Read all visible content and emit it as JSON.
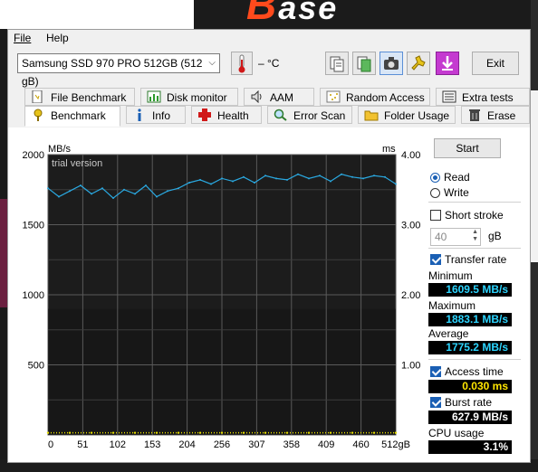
{
  "background": {
    "logo_letter": "B",
    "logo_rest": "ase"
  },
  "menu": {
    "file": "File",
    "help": "Help"
  },
  "toolbar": {
    "drive": "Samsung SSD 970 PRO 512GB (512 gB)",
    "temperature": "– °C",
    "exit": "Exit",
    "icons": [
      "copy-text-icon",
      "copy-info-icon",
      "screenshot-camera-icon",
      "options-icon",
      "save-download-icon"
    ]
  },
  "tabs_row1": [
    "File Benchmark",
    "Disk monitor",
    "AAM",
    "Random Access",
    "Extra tests"
  ],
  "tabs_row2": [
    "Benchmark",
    "Info",
    "Health",
    "Error Scan",
    "Folder Usage",
    "Erase"
  ],
  "selected_tab": "Benchmark",
  "side": {
    "start": "Start",
    "read": "Read",
    "write": "Write",
    "mode": "Read",
    "short_stroke": "Short stroke",
    "short_stroke_checked": false,
    "stroke_value": "40",
    "stroke_unit": "gB",
    "transfer_rate": "Transfer rate",
    "transfer_rate_checked": true,
    "minimum_label": "Minimum",
    "minimum": "1609.5 MB/s",
    "maximum_label": "Maximum",
    "maximum": "1883.1 MB/s",
    "average_label": "Average",
    "average": "1775.2 MB/s",
    "access_time": "Access time",
    "access_time_checked": true,
    "access_time_value": "0.030 ms",
    "burst_rate": "Burst rate",
    "burst_rate_checked": true,
    "burst_rate_value": "627.9 MB/s",
    "cpu_usage_label": "CPU usage",
    "cpu_usage": "3.1%"
  },
  "chart_data": {
    "type": "line",
    "watermark": "trial version",
    "ylabel_left": "MB/s",
    "ylabel_right": "ms",
    "ylim_left": [
      0,
      2000
    ],
    "ylim_right": [
      0,
      4
    ],
    "yticks_left": [
      "2000",
      "1500",
      "1000",
      "500"
    ],
    "yticks_right": [
      "4.00",
      "3.00",
      "2.00",
      "1.00"
    ],
    "xlim": [
      0,
      512
    ],
    "xticks": [
      "0",
      "51",
      "102",
      "153",
      "204",
      "256",
      "307",
      "358",
      "409",
      "460",
      "512gB"
    ],
    "grid": true,
    "colors": {
      "transfer": "#2aa8e0",
      "access": "#e8e000",
      "background": "#1c1c1c"
    },
    "series": [
      {
        "name": "Transfer rate",
        "x": [
          0,
          16,
          32,
          48,
          64,
          80,
          96,
          112,
          128,
          144,
          160,
          176,
          192,
          208,
          224,
          240,
          256,
          272,
          288,
          304,
          320,
          336,
          352,
          368,
          384,
          400,
          416,
          432,
          448,
          464,
          480,
          496,
          512
        ],
        "y": [
          1760,
          1700,
          1740,
          1780,
          1720,
          1760,
          1690,
          1750,
          1720,
          1780,
          1700,
          1740,
          1760,
          1800,
          1820,
          1790,
          1830,
          1810,
          1840,
          1800,
          1850,
          1830,
          1820,
          1860,
          1830,
          1850,
          1810,
          1860,
          1840,
          1830,
          1850,
          1840,
          1790
        ]
      },
      {
        "name": "Access time",
        "x": [
          0,
          32,
          64,
          96,
          128,
          160,
          192,
          224,
          256,
          288,
          320,
          352,
          384,
          416,
          448,
          480,
          512
        ],
        "y": [
          0.03,
          0.03,
          0.03,
          0.03,
          0.03,
          0.03,
          0.03,
          0.03,
          0.03,
          0.03,
          0.03,
          0.03,
          0.03,
          0.03,
          0.03,
          0.03,
          0.03
        ]
      }
    ]
  }
}
